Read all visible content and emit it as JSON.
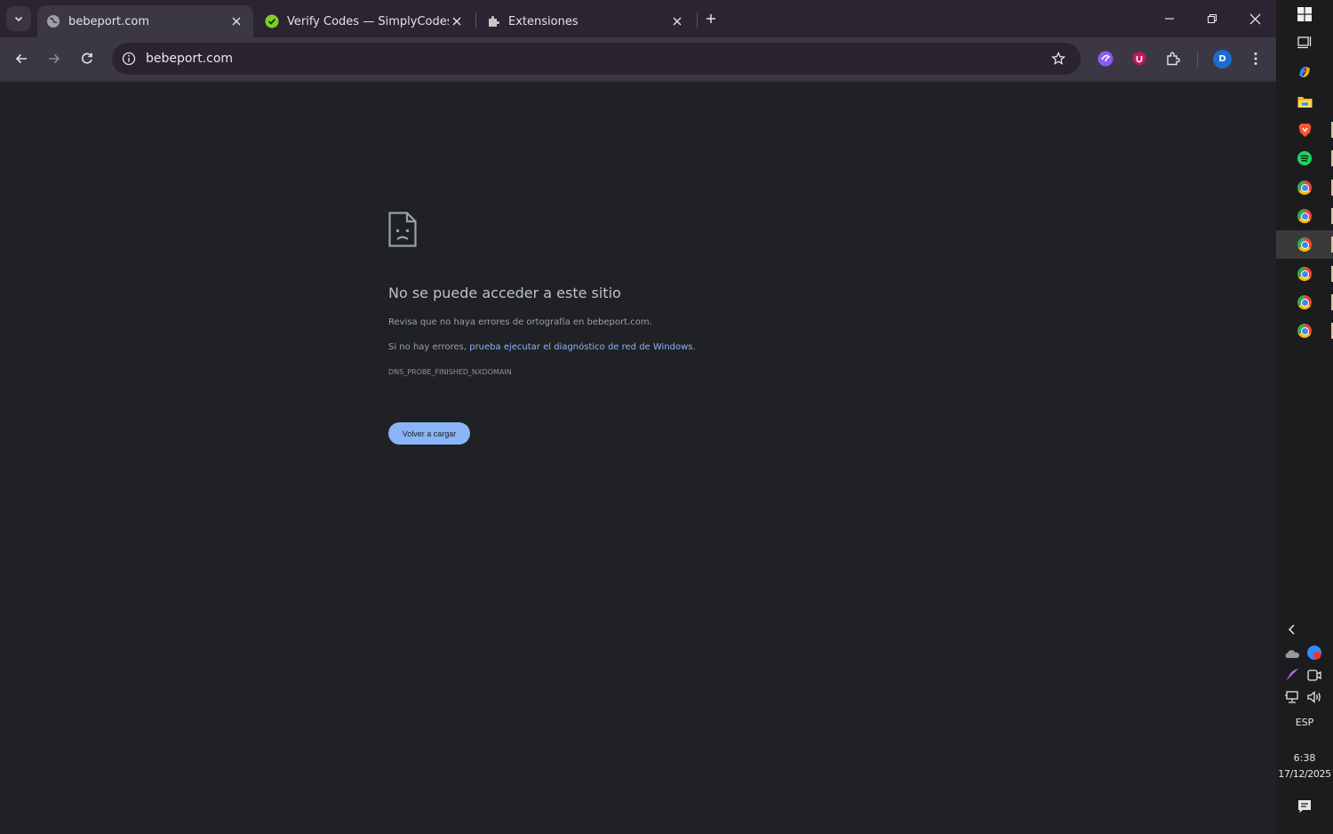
{
  "browser": {
    "tabs": [
      {
        "title": "bebeport.com",
        "favicon": "globe-icon",
        "active": true
      },
      {
        "title": "Verify Codes — SimplyCodes",
        "favicon": "simplycodes-icon",
        "active": false
      },
      {
        "title": "Extensiones",
        "favicon": "puzzle-icon",
        "active": false
      }
    ],
    "address": "bebeport.com",
    "profile_initial": "D"
  },
  "error_page": {
    "title": "No se puede acceder a este sitio",
    "line1": "Revisa que no haya errores de ortografía en bebeport.com.",
    "line2_prefix": "Si no hay errores, ",
    "line2_link": "prueba ejecutar el diagnóstico de red de Windows",
    "line2_suffix": ".",
    "error_code": "DNS_PROBE_FINISHED_NXDOMAIN",
    "reload_label": "Volver a cargar"
  },
  "taskbar": {
    "language": "ESP",
    "time": "6:38",
    "date": "17/12/2025"
  },
  "colors": {
    "page_bg": "#202124",
    "link": "#8ab4f8",
    "button": "#8ab4f8",
    "tabstrip": "#2b2533",
    "toolbar": "#3c3744"
  }
}
